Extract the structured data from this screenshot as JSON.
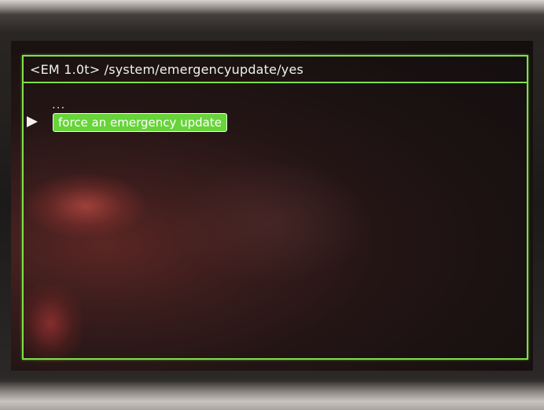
{
  "header": {
    "title": "<EM 1.0t>  /system/emergencyupdate/yes"
  },
  "menu": {
    "parent_item": "...",
    "selected_item": "force an emergency update"
  },
  "colors": {
    "accent": "#7fe04a",
    "selection": "#67d43a",
    "background": "#1a1111"
  },
  "icons": {
    "selection_indicator": "right-arrow-icon"
  }
}
